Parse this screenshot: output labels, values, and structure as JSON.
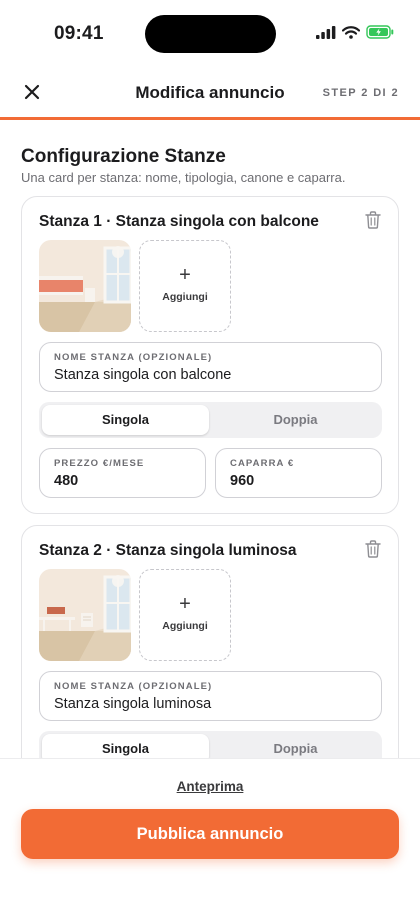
{
  "status_bar": {
    "time": "09:41"
  },
  "header": {
    "title": "Modifica annuncio",
    "step": "STEP 2 DI 2"
  },
  "section": {
    "title": "Configurazione Stanze",
    "subtitle": "Una card per stanza: nome, tipologia, canone e caparra."
  },
  "rooms": [
    {
      "title": "Stanza 1 · Stanza singola con balcone",
      "add_photo_label": "Aggiungi",
      "name_label": "NOME STANZA (OPZIONALE)",
      "name_value": "Stanza singola con balcone",
      "type_options": [
        "Singola",
        "Doppia"
      ],
      "type_selected": "Singola",
      "price_label": "PREZZO €/MESE",
      "price_value": "480",
      "deposit_label": "CAPARRA €",
      "deposit_value": "960"
    },
    {
      "title": "Stanza 2 · Stanza singola luminosa",
      "add_photo_label": "Aggiungi",
      "name_label": "NOME STANZA (OPZIONALE)",
      "name_value": "Stanza singola luminosa",
      "type_options": [
        "Singola",
        "Doppia"
      ],
      "type_selected": "Singola"
    }
  ],
  "footer": {
    "preview_label": "Anteprima",
    "publish_label": "Pubblica annuncio"
  },
  "colors": {
    "accent": "#f26b35",
    "battery": "#34c759"
  },
  "icons": [
    "close-icon",
    "trash-icon",
    "plus-icon",
    "signal-icon",
    "wifi-icon",
    "battery-icon"
  ]
}
